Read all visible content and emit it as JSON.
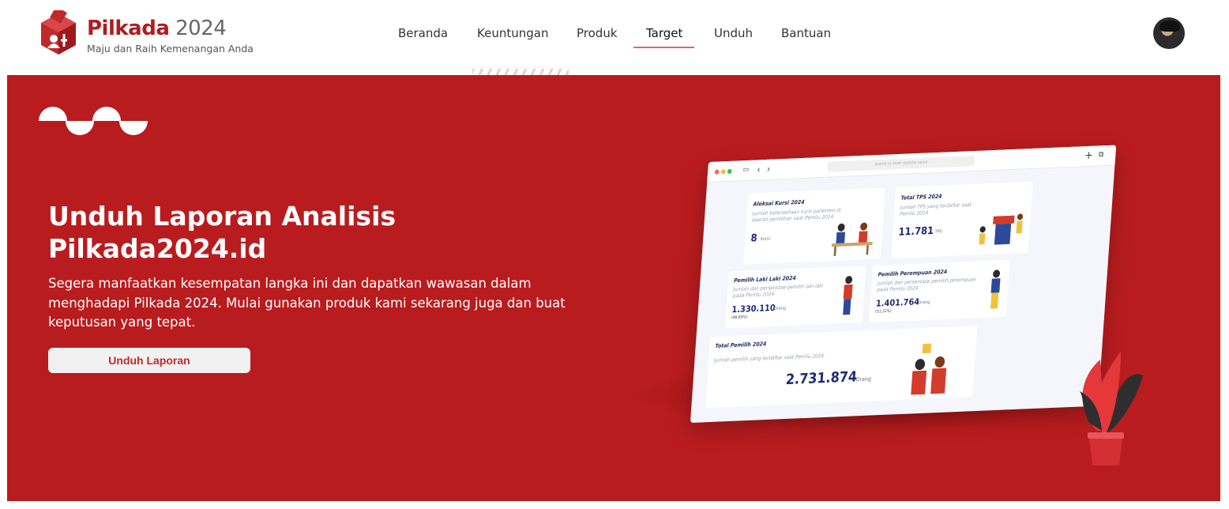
{
  "header": {
    "brand_name": "Pilkada",
    "brand_year": "2024",
    "tagline": "Maju dan Raih Kemenangan Anda",
    "nav": [
      {
        "label": "Beranda"
      },
      {
        "label": "Keuntungan"
      },
      {
        "label": "Produk"
      },
      {
        "label": "Target",
        "active": true
      },
      {
        "label": "Unduh"
      },
      {
        "label": "Bantuan"
      }
    ]
  },
  "hero": {
    "title": "Unduh Laporan Analisis Pilkada2024.id",
    "description": "Segera manfaatkan kesempatan langka ini dan dapatkan wawasan dalam menghadapi Pilkada 2024. Mulai gunakan produk kami sekarang juga dan buat keputusan yang tepat.",
    "button_label": "Unduh Laporan"
  },
  "mockup": {
    "search_placeholder": "Search or enter website name",
    "cards": {
      "kursi": {
        "title": "Aloksai Kursi 2024",
        "subtitle": "Jumlah ketersediaan kursi parlemen di daerah pemilihan saat Pemilu 2024",
        "value": "8",
        "unit": "Kursi"
      },
      "tps": {
        "title": "Total TPS 2024",
        "subtitle": "Jumlah TPS yang terdaftar saat Pemilu 2024",
        "value": "11.781",
        "unit": "TPS"
      },
      "laki": {
        "title": "Pemilih Laki Laki 2024",
        "subtitle": "Jumlah dan persentase pemilih laki-laki pada Pemilu 2024",
        "value": "1.330.110",
        "unit": "Orang",
        "percent": "(48,69%)"
      },
      "perempuan": {
        "title": "Pemilih Perempuan 2024",
        "subtitle": "Jumlah dan persentase pemilih perempuan pada Pemilu 2024",
        "value": "1.401.764",
        "unit": "Orang",
        "percent": "(51,31%)"
      },
      "total": {
        "title": "Total Pemilih 2024",
        "subtitle": "Jumlah pemilih yang terdaftar saat Pemilu 2024",
        "value": "2.731.874",
        "unit": "Orang"
      }
    }
  },
  "colors": {
    "brand_red": "#b91c1e",
    "accent_pink": "#e4636a",
    "navy": "#1e2a78"
  }
}
